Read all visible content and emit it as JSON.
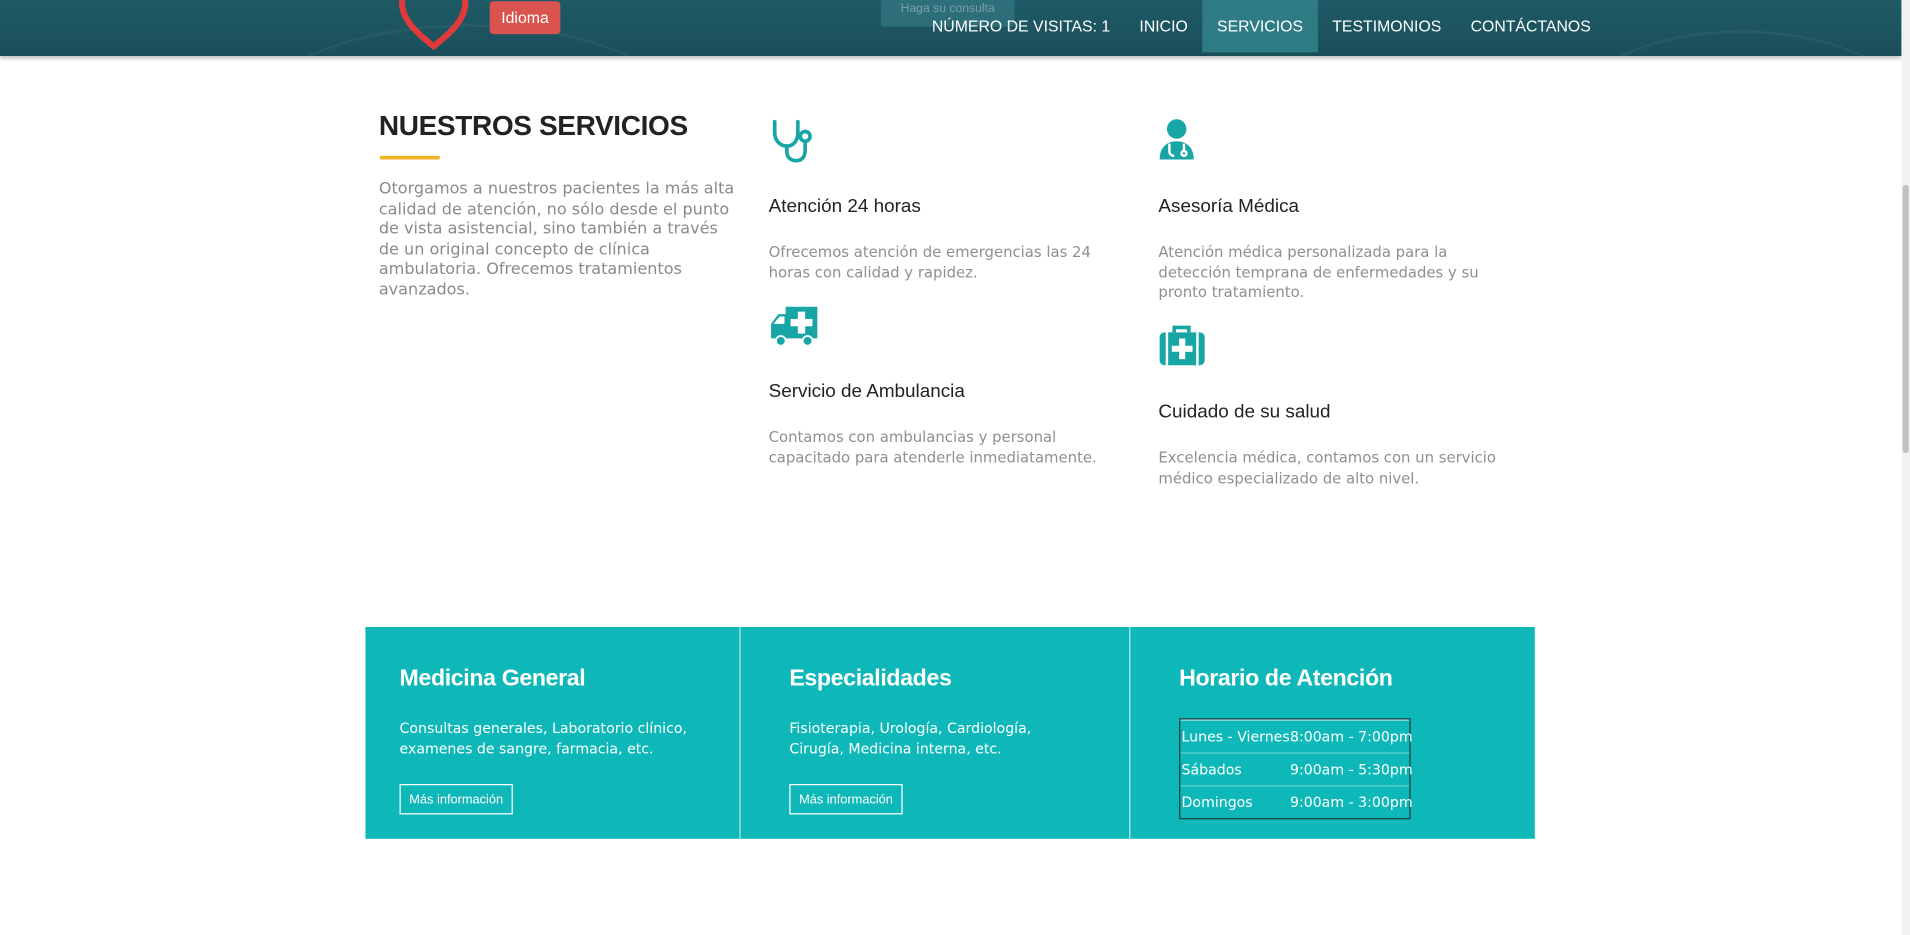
{
  "header": {
    "language_button": "Idioma",
    "ghost_button": "Haga su consulta",
    "nav": [
      {
        "label": "NÚMERO DE VISITAS: 1",
        "active": false
      },
      {
        "label": "INICIO",
        "active": false
      },
      {
        "label": "SERVICIOS",
        "active": true
      },
      {
        "label": "TESTIMONIOS",
        "active": false
      },
      {
        "label": "CONTÁCTANOS",
        "active": false
      }
    ]
  },
  "colors": {
    "header_bg": "#1e5a66",
    "nav_active": "#2f7b84",
    "accent_teal": "#0fb8b8",
    "icon_teal": "#17a5a5",
    "title_underline": "#f0b323",
    "language_button": "#d9534f",
    "logo_heart": "#e03a3a"
  },
  "services_section": {
    "title": "NUESTROS SERVICIOS",
    "intro": "Otorgamos a nuestros pacientes la más alta calidad de atención, no sólo desde el punto de vista asistencial, sino también a través de un original concepto de clínica ambulatoria. Ofrecemos tratamientos avanzados.",
    "items": [
      {
        "icon": "stethoscope-icon",
        "title": "Atención 24 horas",
        "text": "Ofrecemos atención de emergencias las 24 horas con calidad y rapidez."
      },
      {
        "icon": "doctor-icon",
        "title": "Asesoría Médica",
        "text": "Atención médica personalizada para la detección temprana de enfermedades y su pronto tratamiento."
      },
      {
        "icon": "ambulance-icon",
        "title": "Servicio de Ambulancia",
        "text": "Contamos con ambulancias y personal capacitado para atenderle inmediatamente."
      },
      {
        "icon": "medical-kit-icon",
        "title": "Cuidado de su salud",
        "text": "Excelencia médica, contamos con un servicio médico especializado de alto nivel."
      }
    ]
  },
  "info_boxes": {
    "general": {
      "title": "Medicina General",
      "text": "Consultas generales, Laboratorio clínico, examenes de sangre, farmacia, etc.",
      "button": "Más información"
    },
    "specialties": {
      "title": "Especialidades",
      "text": "Fisioterapia, Urología, Cardiología, Cirugía, Medicina interna, etc.",
      "button": "Más información"
    },
    "schedule": {
      "title": "Horario de Atención",
      "rows": [
        {
          "day": "Lunes - Viernes",
          "time": "8:00am - 7:00pm"
        },
        {
          "day": "Sábados",
          "time": "9:00am - 5:30pm"
        },
        {
          "day": "Domingos",
          "time": "9:00am - 3:00pm"
        }
      ]
    }
  }
}
